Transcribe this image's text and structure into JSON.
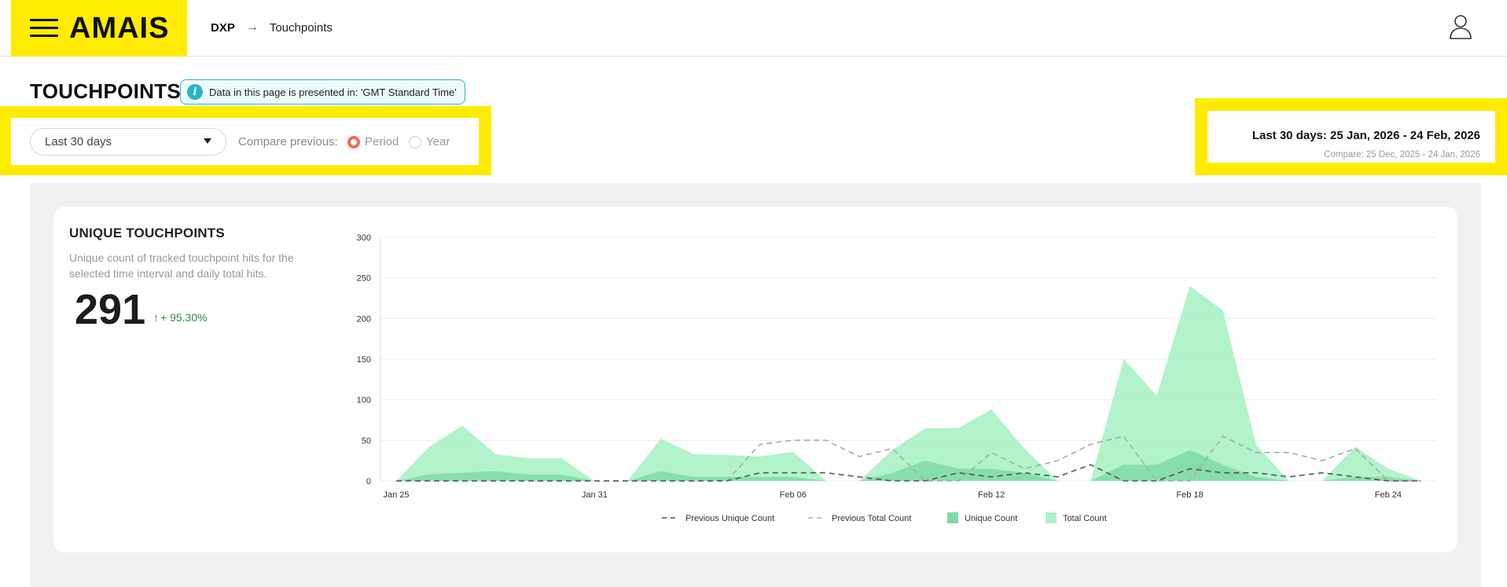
{
  "header": {
    "logo": "AMAIS",
    "breadcrumb": {
      "root": "DXP",
      "arrow": "→",
      "current": "Touchpoints"
    }
  },
  "page": {
    "title": "TOUCHPOINTS",
    "timezone_note": "Data in this page is presented in: 'GMT Standard Time'"
  },
  "filters": {
    "range_value": "Last 30 days",
    "compare_label": "Compare previous:",
    "options": [
      {
        "label": "Period",
        "checked": true
      },
      {
        "label": "Year",
        "checked": false
      }
    ]
  },
  "summary": {
    "range_text": "Last 30 days: 25 Jan, 2026 - 24 Feb, 2026",
    "compare_text": "Compare: 25 Dec, 2025 - 24 Jan, 2026"
  },
  "card": {
    "title": "UNIQUE TOUCHPOINTS",
    "description": "Unique count of tracked touchpoint hits for the selected time interval and daily total hits.",
    "value": "291",
    "delta": "+ 95.30%",
    "delta_color": "#2e8b3a"
  },
  "colors": {
    "accent_yellow": "#ffec00",
    "total_area": "#aef2c8",
    "unique_area": "#7fd9a8",
    "prev_unique_line": "#555555",
    "prev_total_line": "#a9a9a9",
    "radio_selected": "#f26b5b",
    "info_teal": "#2bb5c4"
  },
  "chart_data": {
    "type": "area",
    "ylim": [
      0,
      300
    ],
    "yticks": [
      0,
      50,
      100,
      150,
      200,
      250,
      300
    ],
    "x": [
      "Jan 25",
      "Jan 26",
      "Jan 27",
      "Jan 28",
      "Jan 29",
      "Jan 30",
      "Jan 31",
      "Feb 01",
      "Feb 02",
      "Feb 03",
      "Feb 04",
      "Feb 05",
      "Feb 06",
      "Feb 07",
      "Feb 08",
      "Feb 09",
      "Feb 10",
      "Feb 11",
      "Feb 12",
      "Feb 13",
      "Feb 14",
      "Feb 15",
      "Feb 16",
      "Feb 17",
      "Feb 18",
      "Feb 19",
      "Feb 20",
      "Feb 21",
      "Feb 22",
      "Feb 23",
      "Feb 24",
      "Feb 25"
    ],
    "xticks": [
      "Jan 25",
      "Jan 31",
      "Feb 06",
      "Feb 12",
      "Feb 18",
      "Feb 24"
    ],
    "series": [
      {
        "name": "Previous Unique Count",
        "style": "dashed-line",
        "values": [
          0,
          0,
          0,
          0,
          0,
          0,
          0,
          0,
          0,
          0,
          0,
          10,
          10,
          10,
          5,
          0,
          0,
          10,
          5,
          10,
          5,
          20,
          0,
          0,
          15,
          10,
          10,
          5,
          10,
          5,
          0,
          0
        ]
      },
      {
        "name": "Previous Total Count",
        "style": "dashed-line",
        "values": [
          0,
          0,
          0,
          0,
          0,
          0,
          0,
          0,
          0,
          0,
          0,
          45,
          50,
          50,
          30,
          40,
          0,
          0,
          35,
          15,
          25,
          45,
          55,
          0,
          0,
          55,
          35,
          35,
          25,
          40,
          0,
          0
        ]
      },
      {
        "name": "Unique Count",
        "style": "area",
        "values": [
          0,
          8,
          10,
          12,
          8,
          8,
          0,
          0,
          12,
          5,
          5,
          5,
          5,
          0,
          0,
          10,
          25,
          15,
          15,
          10,
          0,
          0,
          20,
          20,
          38,
          20,
          5,
          0,
          0,
          5,
          5,
          0
        ]
      },
      {
        "name": "Total Count",
        "style": "area",
        "values": [
          0,
          42,
          68,
          33,
          28,
          28,
          0,
          0,
          52,
          33,
          32,
          30,
          36,
          0,
          0,
          38,
          65,
          65,
          88,
          40,
          0,
          0,
          150,
          105,
          240,
          210,
          45,
          0,
          0,
          42,
          15,
          0
        ]
      }
    ]
  }
}
